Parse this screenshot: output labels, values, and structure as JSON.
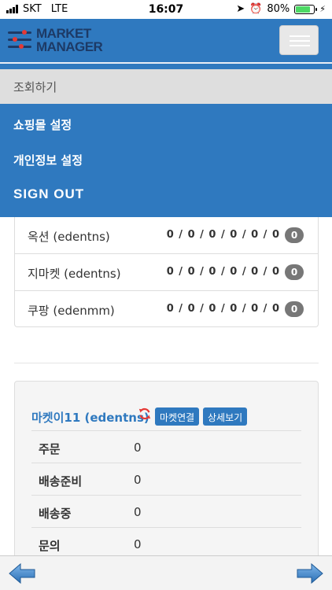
{
  "status_bar": {
    "carrier": "SKT",
    "network": "LTE",
    "time": "16:07",
    "battery": "80%",
    "battery_level": 0.8
  },
  "header": {
    "logo_line1": "MARKET",
    "logo_line2": "MANAGER",
    "menu_icon": "hamburger-icon"
  },
  "menu": {
    "active_item": "조회하기",
    "items": [
      "쇼핑몰 설정",
      "개인정보 설정"
    ],
    "sign_out": "SIGN OUT"
  },
  "accounts": [
    {
      "name": "옥션 (edentns)",
      "counts": "0 / 0 / 0 / 0 / 0 / 0",
      "badge": "0"
    },
    {
      "name": "지마켓 (edentns)",
      "counts": "0 / 0 / 0 / 0 / 0 / 0",
      "badge": "0"
    },
    {
      "name": "쿠팡 (edenmm)",
      "counts": "0 / 0 / 0 / 0 / 0 / 0",
      "badge": "0"
    }
  ],
  "market_card": {
    "title": "마켓이11 (edentns)",
    "connect_button": "마켓연결",
    "detail_button": "상세보기",
    "stats": [
      {
        "label": "주문",
        "value": "0"
      },
      {
        "label": "배송준비",
        "value": "0"
      },
      {
        "label": "배송중",
        "value": "0"
      },
      {
        "label": "문의",
        "value": "0"
      }
    ]
  },
  "bottom_bar": {
    "back_icon": "arrow-left-icon",
    "forward_icon": "arrow-right-icon"
  },
  "colors": {
    "primary": "#2f79bf",
    "menu_active_bg": "#dedede",
    "badge": "#777777",
    "refresh": "#e53935"
  }
}
